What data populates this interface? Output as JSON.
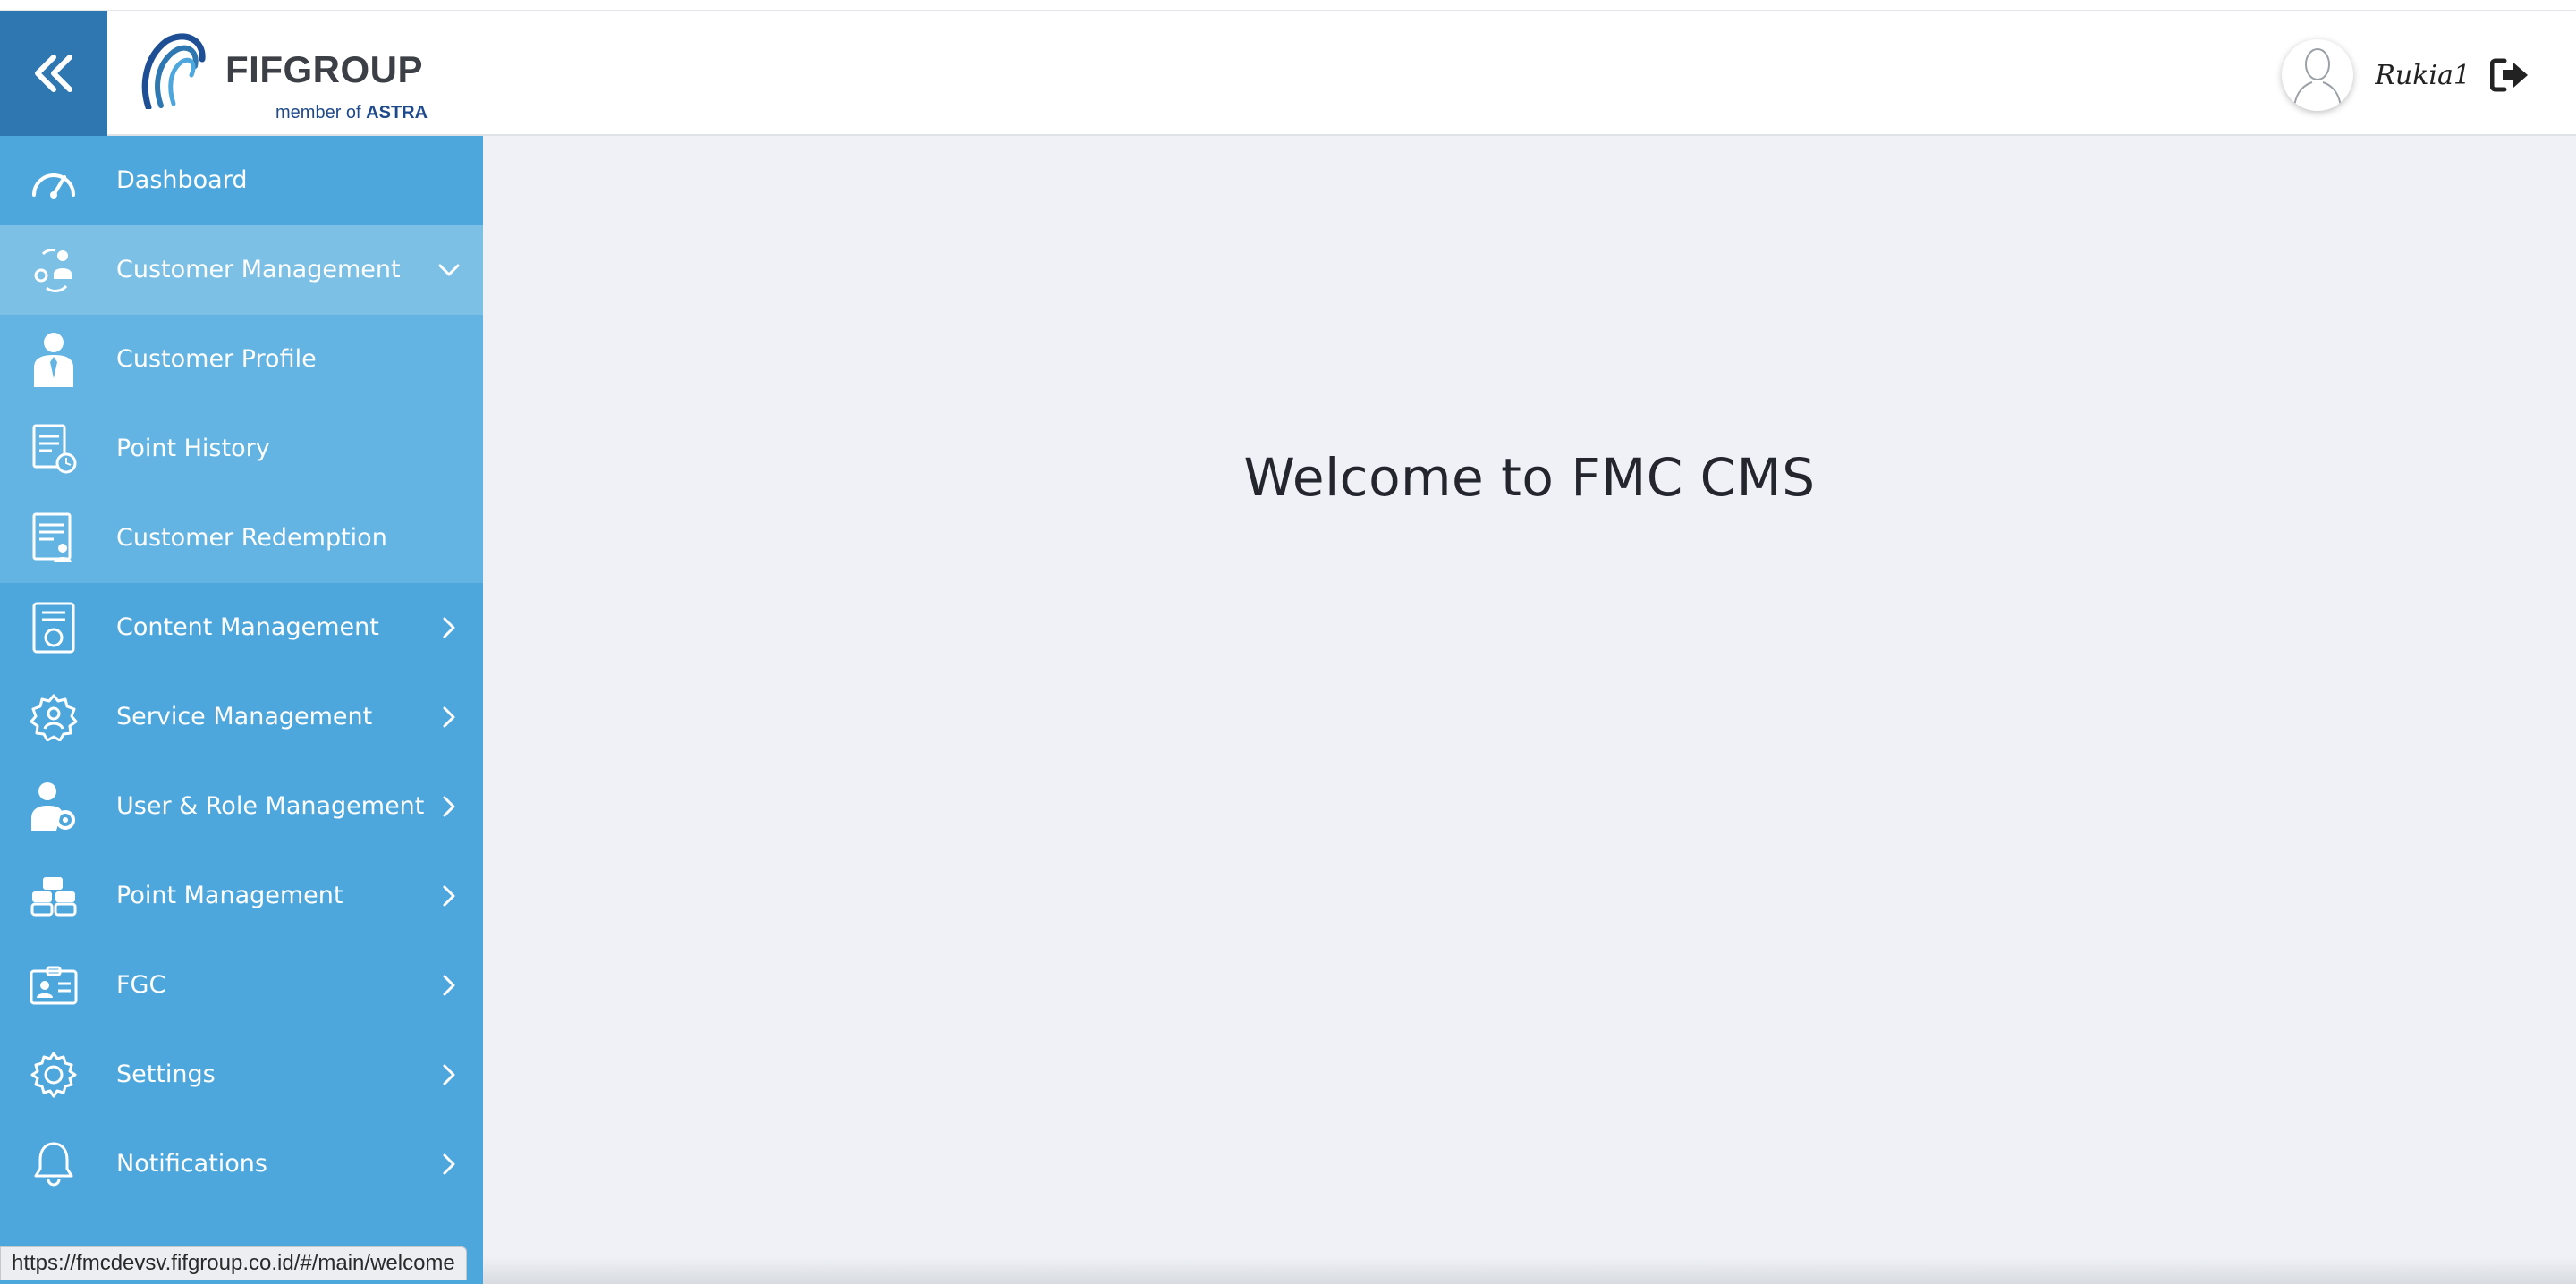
{
  "header": {
    "logo_text": "FIFGROUP",
    "logo_sub_prefix": "member of",
    "logo_sub_brand": "ASTRA",
    "username": "Rukia1"
  },
  "sidebar": {
    "items": [
      {
        "label": "Dashboard",
        "icon": "speedometer-icon",
        "state": "default",
        "arrow": "none"
      },
      {
        "label": "Customer Management",
        "icon": "customer-group-icon",
        "state": "expanded",
        "arrow": "chevron-down"
      },
      {
        "label": "Customer Profile",
        "icon": "person-icon",
        "state": "sub",
        "arrow": "none"
      },
      {
        "label": "Point History",
        "icon": "document-clock-icon",
        "state": "sub",
        "arrow": "none"
      },
      {
        "label": "Customer Redemption",
        "icon": "document-user-icon",
        "state": "sub",
        "arrow": "none"
      },
      {
        "label": "Content Management",
        "icon": "content-doc-icon",
        "state": "default",
        "arrow": "chevron-right"
      },
      {
        "label": "Service Management",
        "icon": "service-gear-icon",
        "state": "default",
        "arrow": "chevron-right"
      },
      {
        "label": "User & Role Management",
        "icon": "user-gear-icon",
        "state": "default",
        "arrow": "chevron-right"
      },
      {
        "label": "Point Management",
        "icon": "coins-stack-icon",
        "state": "default",
        "arrow": "chevron-right"
      },
      {
        "label": "FGC",
        "icon": "id-card-icon",
        "state": "default",
        "arrow": "chevron-right"
      },
      {
        "label": "Settings",
        "icon": "gear-icon",
        "state": "default",
        "arrow": "chevron-right"
      },
      {
        "label": "Notifications",
        "icon": "bell-icon",
        "state": "default",
        "arrow": "chevron-right"
      }
    ]
  },
  "main": {
    "title": "Welcome to FMC CMS"
  },
  "status_bar": {
    "url": "https://fmcdevsv.fifgroup.co.id/#/main/welcome"
  },
  "colors": {
    "sidebar": "#4ea7dc",
    "sidebar_expanded": "#7cc0e6",
    "sidebar_sub": "#63b4e3",
    "collapse_button": "#2f77b0",
    "content_background": "#eff1f6"
  }
}
